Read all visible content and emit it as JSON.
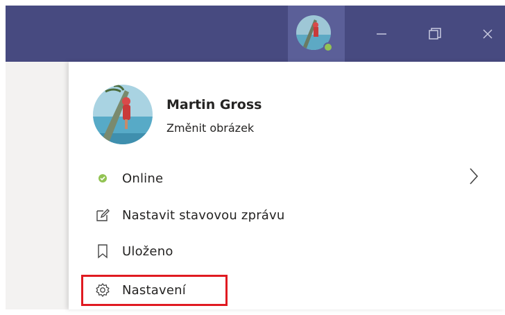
{
  "titlebar": {
    "buttons": {
      "minimize": "minimize-icon",
      "maximize": "restore-icon",
      "close": "close-icon"
    }
  },
  "profile": {
    "name": "Martin Gross",
    "change_picture": "Změnit obrázek",
    "status_color": "#92c353"
  },
  "menu": {
    "items": [
      {
        "label": "Online",
        "icon": "status-dot-icon",
        "has_submenu": true
      },
      {
        "label": "Nastavit stavovou zprávu",
        "icon": "edit-icon"
      },
      {
        "label": "Uloženo",
        "icon": "bookmark-icon"
      },
      {
        "label": "Nastavení",
        "icon": "gear-icon"
      }
    ]
  },
  "colors": {
    "titlebar": "#474a80",
    "avatar_button": "#5b5f98",
    "highlight": "#e01a21",
    "left_pane": "#f3f2f1"
  }
}
